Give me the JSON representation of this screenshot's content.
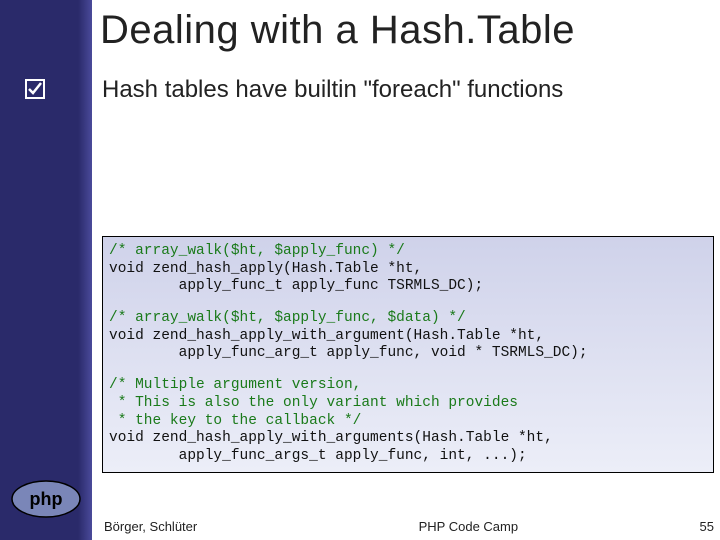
{
  "title": "Dealing with a Hash.Table",
  "bullet": "Hash tables have builtin \"foreach\" functions",
  "check_icon": "checkbox-checked-icon",
  "logo_label": "php",
  "code": {
    "b1": {
      "c": "/* array_walk($ht, $apply_func) */",
      "l1": "void zend_hash_apply(Hash.Table *ht,",
      "l2": "        apply_func_t apply_func TSRMLS_DC);"
    },
    "b2": {
      "c": "/* array_walk($ht, $apply_func, $data) */",
      "l1": "void zend_hash_apply_with_argument(Hash.Table *ht,",
      "l2": "        apply_func_arg_t apply_func, void * TSRMLS_DC);"
    },
    "b3": {
      "c1": "/* Multiple argument version,",
      "c2": " * This is also the only variant which provides",
      "c3": " * the key to the callback */",
      "l1": "void zend_hash_apply_with_arguments(Hash.Table *ht,",
      "l2": "        apply_func_args_t apply_func, int, ...);"
    }
  },
  "footer": {
    "authors": "Börger, Schlüter",
    "event": "PHP Code Camp",
    "page": "55"
  }
}
